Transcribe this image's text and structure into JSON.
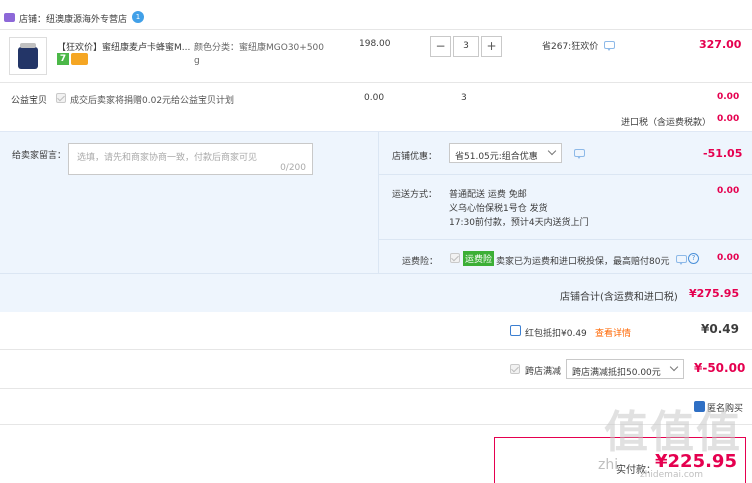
{
  "shop": {
    "label": "店铺：纽澳康源海外专营店",
    "badge": "1"
  },
  "item": {
    "title": "【狂欢价】蜜纽康麦卢卡蜂蜜M...",
    "tag_number": "7",
    "sku_line1": "颜色分类：蜜纽康MGO30+500",
    "sku_line2": "g",
    "unit_price": "198.00",
    "quantity": "3",
    "minus": "−",
    "plus": "+",
    "saving": "省267:狂欢价",
    "subtotal": "327.00"
  },
  "charity": {
    "label": "公益宝贝",
    "text": "成交后卖家将捐赠0.02元给公益宝贝计划",
    "price": "0.00",
    "qty": "3",
    "amount": "0.00"
  },
  "import_tax": {
    "label": "进口税（含运费税款）",
    "amount": "0.00"
  },
  "message": {
    "label": "给卖家留言：",
    "placeholder": "选填，请先和商家协商一致，付款后商家可见",
    "counter": "0/200"
  },
  "discount": {
    "label": "店铺优惠：",
    "selected": "省51.05元:组合优惠",
    "amount": "-51.05"
  },
  "shipping": {
    "label": "运送方式：",
    "line1": "普通配送 运费 免邮",
    "line2": "义乌心怡保税1号仓  发货",
    "line3": "17:30前付款，预计4天内送货上门",
    "amount": "0.00"
  },
  "insurance": {
    "label": "运费险：",
    "badge": "运费险",
    "text": "卖家已为运费和进口税投保，最高赔付80元",
    "help": "?",
    "amount": "0.00"
  },
  "shop_total": {
    "label": "店铺合计(含运费和进口税)",
    "amount": "¥275.95"
  },
  "red_packet": {
    "label": "红包抵扣¥0.49",
    "link": "查看详情",
    "amount": "¥0.49"
  },
  "cross_store": {
    "label": "跨店满减",
    "selected": "跨店满减抵扣50.00元",
    "amount": "¥-50.00"
  },
  "anonymous": {
    "label": "匿名购买"
  },
  "pay": {
    "label": "实付款：",
    "amount": "¥225.95"
  },
  "watermark": {
    "big": "值",
    "small": "zhi",
    "site": "zhidemai.com"
  },
  "colors": {
    "accent": "#e5004f",
    "link": "#ff6600",
    "panel": "#eef5fd",
    "chat": "#8db9e8"
  }
}
